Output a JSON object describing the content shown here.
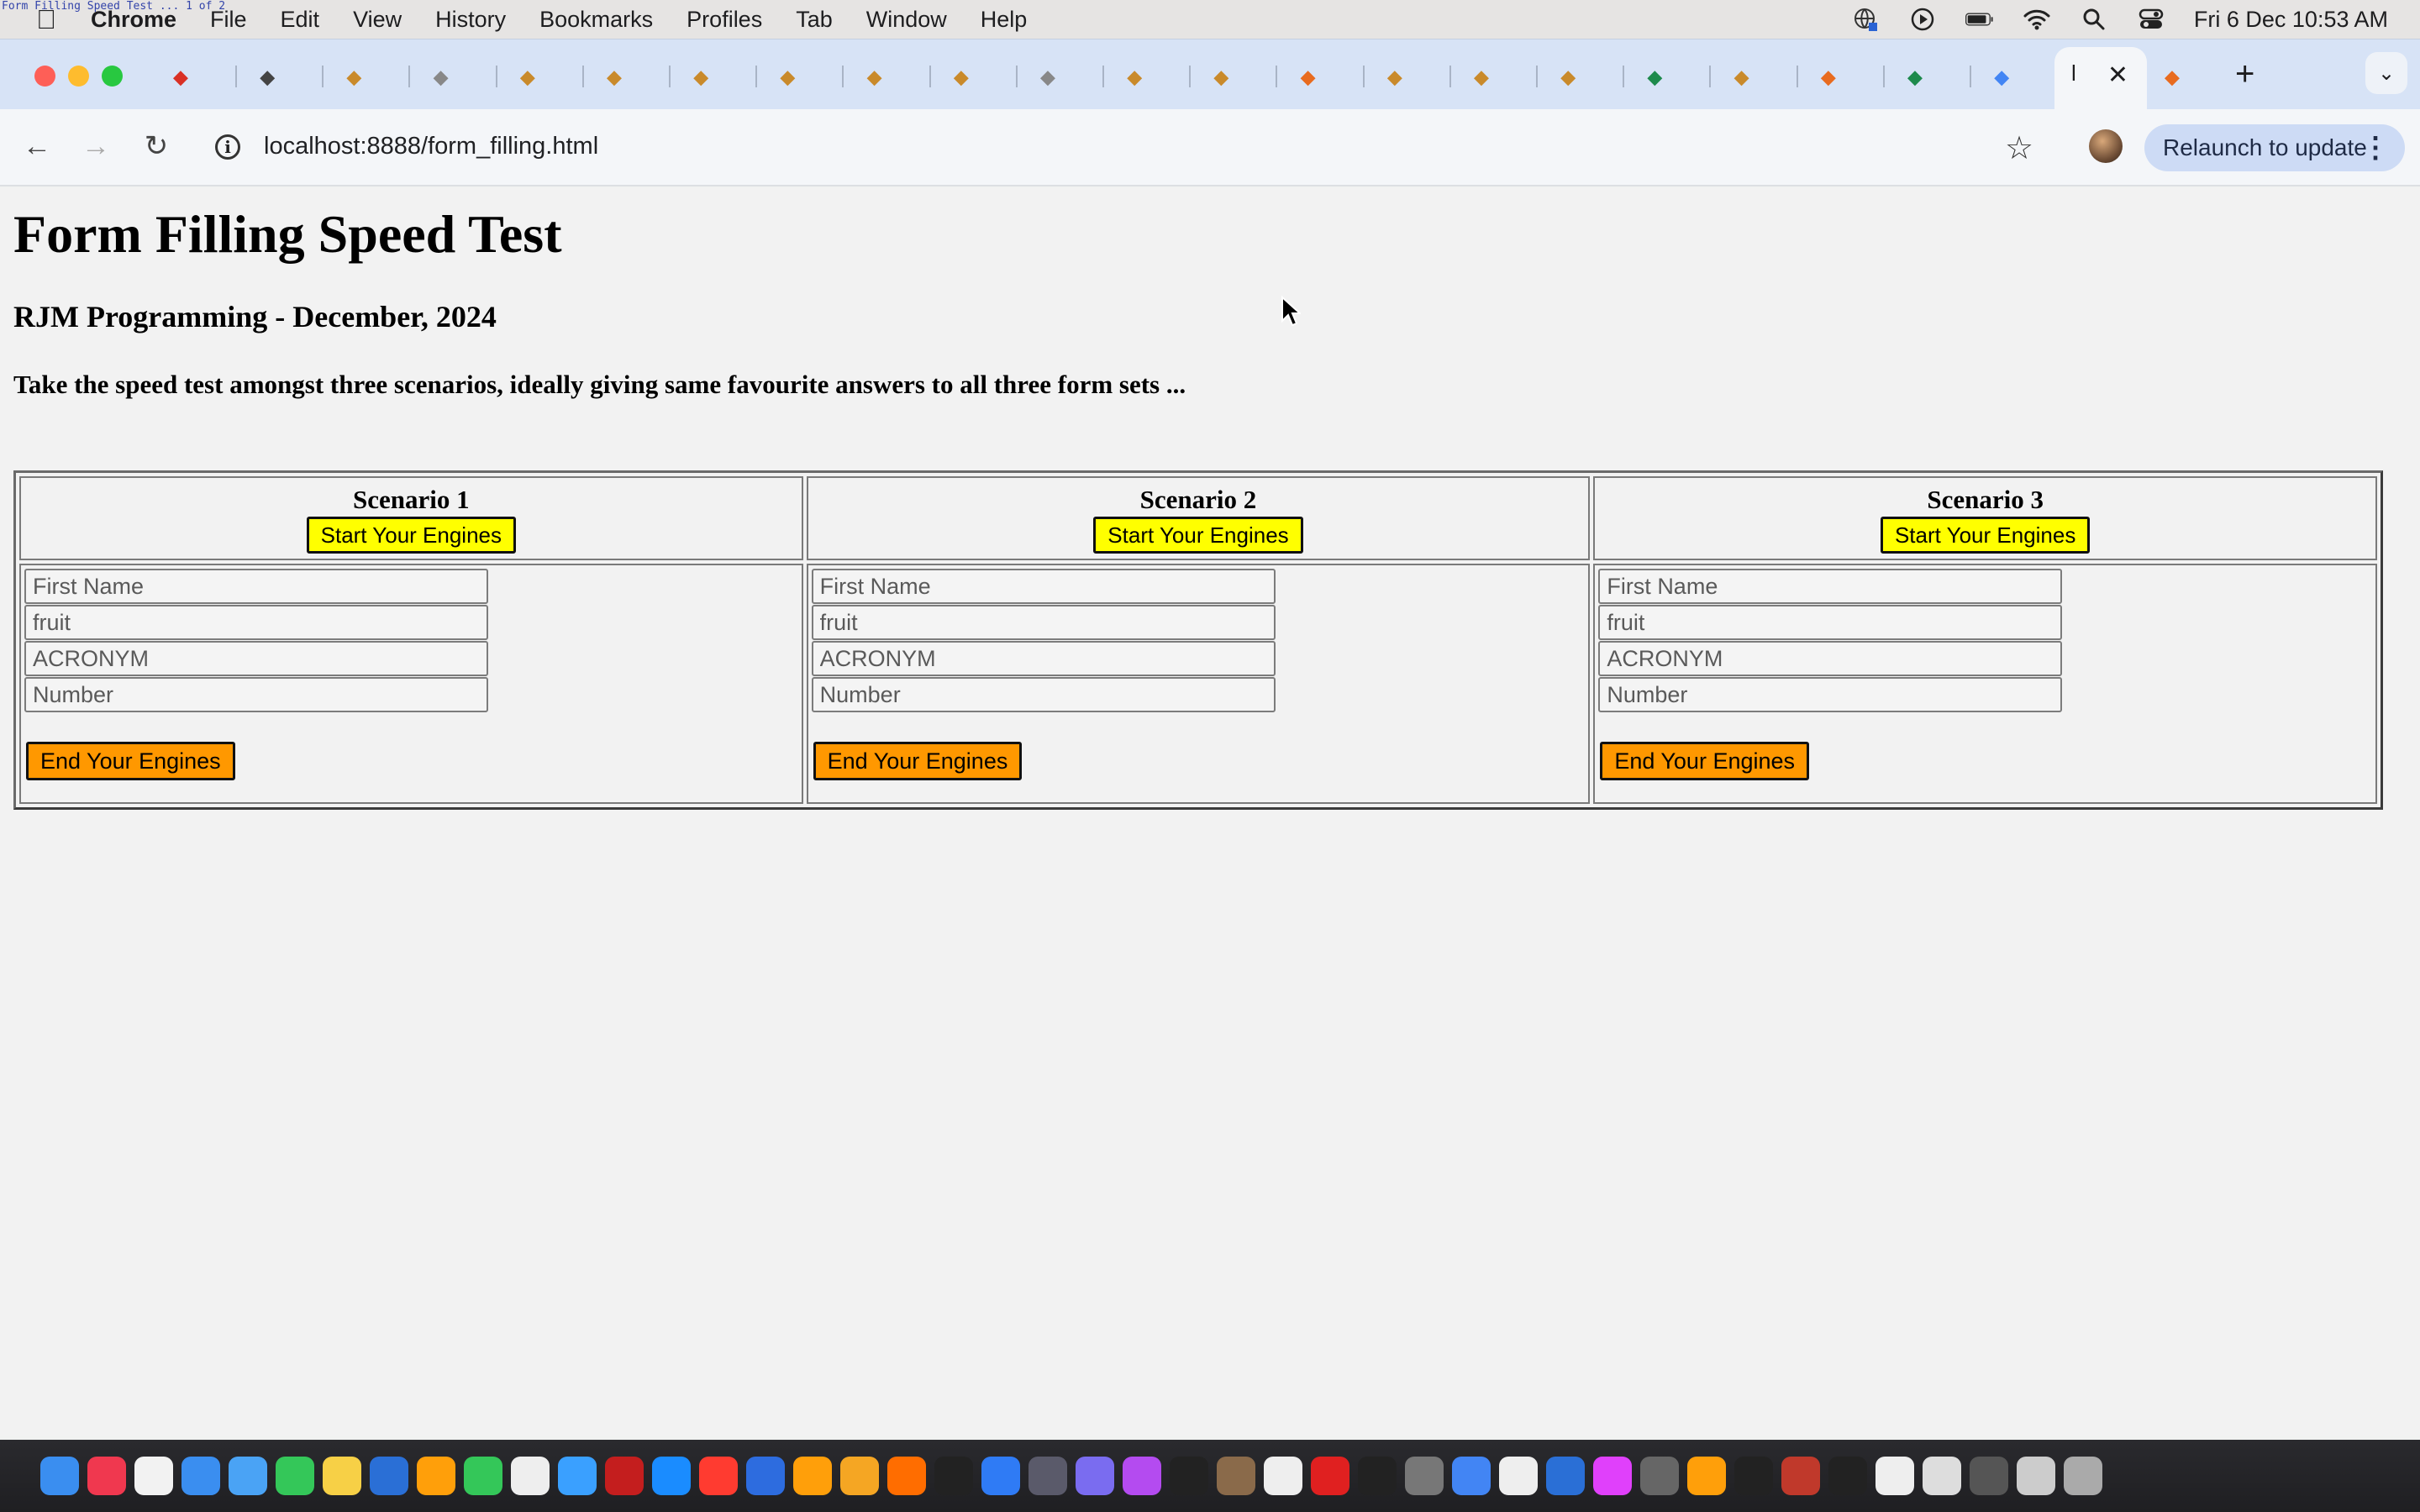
{
  "window_title_tiny": "Form Filling Speed Test ... 1 of 2",
  "menubar": {
    "app_name": "Chrome",
    "items": [
      "File",
      "Edit",
      "View",
      "History",
      "Bookmarks",
      "Profiles",
      "Tab",
      "Window",
      "Help"
    ],
    "clock": "Fri 6 Dec  10:53 AM",
    "status_icons": [
      "translate-icon",
      "play-icon",
      "battery-icon",
      "wifi-icon",
      "search-icon",
      "control-center-icon"
    ]
  },
  "tabs": {
    "active_title": "l",
    "count_shown": 25
  },
  "toolbar": {
    "url": "localhost:8888/form_filling.html",
    "relaunch_label": "Relaunch to update"
  },
  "page": {
    "title": "Form Filling Speed Test",
    "subtitle": "RJM Programming - December, 2024",
    "instructions": "Take the speed test amongst three scenarios, ideally giving same favourite answers to all three form sets ...",
    "scenarios": [
      {
        "title": "Scenario 1",
        "start_label": "Start Your Engines",
        "end_label": "End Your Engines",
        "placeholders": {
          "first_name": "First Name",
          "fruit": "fruit",
          "acronym": "ACRONYM",
          "number": "Number"
        }
      },
      {
        "title": "Scenario 2",
        "start_label": "Start Your Engines",
        "end_label": "End Your Engines",
        "placeholders": {
          "first_name": "First Name",
          "fruit": "fruit",
          "acronym": "ACRONYM",
          "number": "Number"
        }
      },
      {
        "title": "Scenario 3",
        "start_label": "Start Your Engines",
        "end_label": "End Your Engines",
        "placeholders": {
          "first_name": "First Name",
          "fruit": "fruit",
          "acronym": "ACRONYM",
          "number": "Number"
        }
      }
    ]
  },
  "colors": {
    "start_button": "#ffff00",
    "end_button": "#ff9800",
    "tab_strip": "#d7e3f6",
    "relaunch_button": "#cddbf5"
  }
}
